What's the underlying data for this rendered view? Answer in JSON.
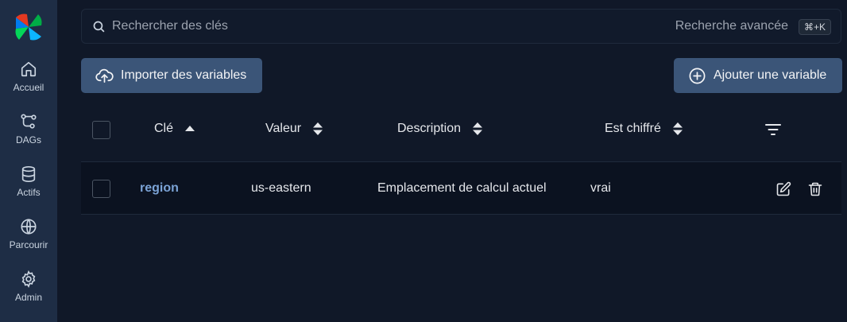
{
  "sidebar": {
    "logo": "airflow-pinwheel-logo",
    "items": [
      {
        "label": "Accueil",
        "icon": "home-icon"
      },
      {
        "label": "DAGs",
        "icon": "dags-icon"
      },
      {
        "label": "Actifs",
        "icon": "database-icon"
      },
      {
        "label": "Parcourir",
        "icon": "globe-icon"
      },
      {
        "label": "Admin",
        "icon": "gear-icon"
      }
    ]
  },
  "search": {
    "placeholder": "Rechercher des clés",
    "advanced_label": "Recherche avancée",
    "shortcut": "⌘+K"
  },
  "toolbar": {
    "import_label": "Importer des variables",
    "add_label": "Ajouter une variable"
  },
  "table": {
    "columns": [
      "Clé",
      "Valeur",
      "Description",
      "Est chiffré"
    ],
    "sorted_column": "Clé",
    "rows": [
      {
        "key": "region",
        "value": "us-eastern",
        "description": "Emplacement de calcul actuel",
        "encrypted": "vrai"
      }
    ]
  },
  "colors": {
    "background": "#101828",
    "sidebar": "#1e2d45",
    "button": "#3b5578",
    "link": "#7ba3d6"
  }
}
